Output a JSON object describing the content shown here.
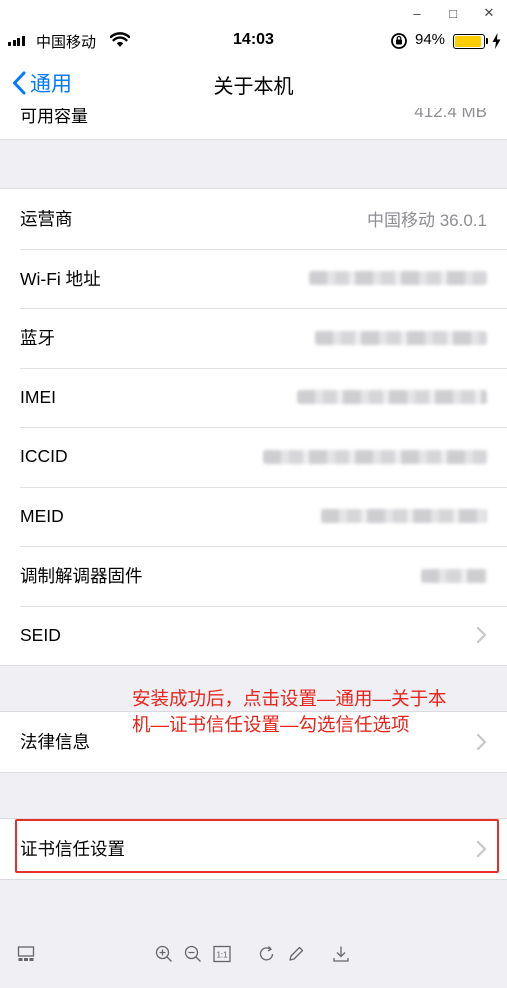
{
  "window": {
    "minimize": "–",
    "maximize": "□",
    "close": "✕"
  },
  "status": {
    "carrier": "中国移动",
    "time": "14:03",
    "battery_pct": "94%",
    "battery_level": 0.94,
    "battery_color": "#ffcc00"
  },
  "nav": {
    "back_label": "通用",
    "title": "关于本机"
  },
  "partial_row": {
    "label": "可用容量",
    "value": "412.4 MB"
  },
  "info_rows": [
    {
      "label": "运营商",
      "value": "中国移动 36.0.1"
    },
    {
      "label": "Wi-Fi 地址",
      "value": ""
    },
    {
      "label": "蓝牙",
      "value": ""
    },
    {
      "label": "IMEI",
      "value": ""
    },
    {
      "label": "ICCID",
      "value": ""
    },
    {
      "label": "MEID",
      "value": ""
    },
    {
      "label": "调制解调器固件",
      "value": ""
    },
    {
      "label": "SEID",
      "value": ""
    }
  ],
  "legal": {
    "label": "法律信息"
  },
  "cert": {
    "label": "证书信任设置"
  },
  "annotation": {
    "text": "安装成功后，点击设置—通用—关于本机—证书信任设置—勾选信任选项",
    "color": "#e8251c"
  },
  "accent_color": "#007aff",
  "toolbar_icons": [
    "thumbnail-icon",
    "zoom-in-icon",
    "zoom-out-icon",
    "actual-size-icon",
    "rotate-icon",
    "edit-icon",
    "download-icon"
  ],
  "toolbar": {
    "actual_size_label": "1:1"
  }
}
